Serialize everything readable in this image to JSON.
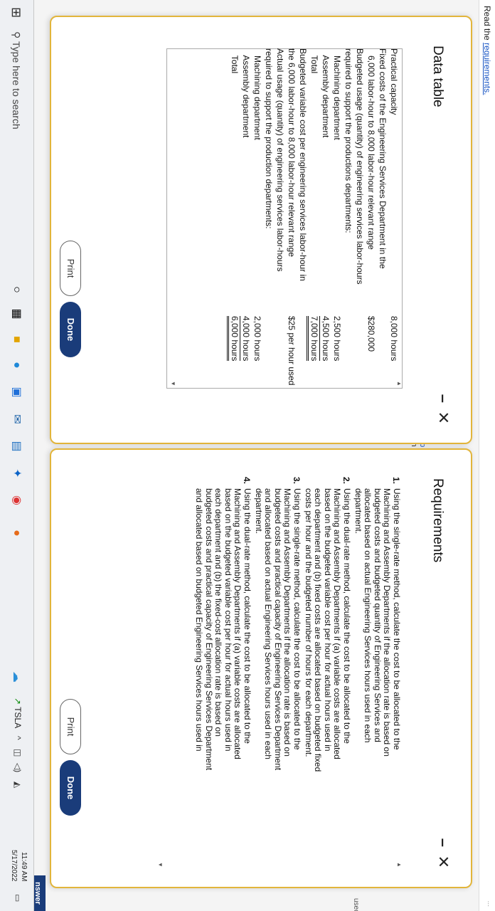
{
  "background": {
    "read_text": "Read the ",
    "read_link": "requirements.",
    "corner_text": "...",
    "used_text": "used",
    "answer_button": "nswer",
    "frag1": "ep",
    "frag2": "im"
  },
  "data_dialog": {
    "title": "Data table",
    "rows": [
      {
        "label": "Practical capacity",
        "value": "8,000 hours"
      },
      {
        "label": "Fixed costs of the Engineering Services Department in the",
        "value": ""
      },
      {
        "label": "   6,000 labor-hour to 8,000 labor-hour relevant range",
        "value": "$280,000"
      },
      {
        "label": "Budgeted usage (quantity) of engineering services labor-hours",
        "value": ""
      },
      {
        "label": "required to support the productions departments:",
        "value": ""
      },
      {
        "label": "   Machining department",
        "value": "2,500 hours"
      },
      {
        "label": "   Assembly department",
        "value": "4,500 hours"
      },
      {
        "label": "   Total",
        "value": "7,000 hours"
      },
      {
        "label": "Budgeted variable cost per engineering services labor-hour in",
        "value": ""
      },
      {
        "label": "the 6,000 labor-hour to 8,000 labor-hour relevant range",
        "value": "$25 per hour used"
      },
      {
        "label": "Actual usage (quantity) of engineering services labor-hours",
        "value": ""
      },
      {
        "label": "required to support the production departments:",
        "value": ""
      },
      {
        "label": "   Machining department",
        "value": "2,000 hours"
      },
      {
        "label": "   Assembly department",
        "value": "4,000 hours"
      },
      {
        "label": "   Total",
        "value": "6,000 hours"
      }
    ],
    "print_label": "Print",
    "done_label": "Done"
  },
  "req_dialog": {
    "title": "Requirements",
    "items": [
      {
        "num": "1.",
        "lines": [
          "Using the single-rate method, calculate the cost to be allocated to the",
          "Machining and Assembly Departments if the allocation rate is based on",
          "budgeted costs and budgeted quantity of Engineering Services and",
          "allocated based on actual Engineering Services hours used in each",
          "department."
        ]
      },
      {
        "num": "2.",
        "lines": [
          "Using the dual-rate method, calculate the cost to be allocated to the",
          "Machining and Assembly Departments if (a) variable costs are allocated",
          "based on the budgeted variable cost per hour for actual hours used in",
          "each department and (b) fixed costs are allocated based on budgeted fixed",
          "costs per hour and the budgeted number of hours for each department."
        ]
      },
      {
        "num": "3.",
        "lines": [
          "Using the single-rate method, calculate the cost to be allocated to the",
          "Machining and Assembly Departments if the allocation rate is based on",
          "budgeted costs and practical capacity of Engineering Services Department",
          "and allocated based on actual Engineering Services hours used in each",
          "department."
        ]
      },
      {
        "num": "4.",
        "lines": [
          "Using the dual-rate method, calculate the cost to be allocated to the",
          "Machining and Assembly Departments if (a) variable costs are allocated",
          "based on the budgeted variable cost per hour for actual hours used in",
          "each department and (b) the fixed-cost allocation rate is based on",
          "budgeted costs and practical capacity of Engineering Services Department",
          "and allocated based on budgeted Engineering Services hours used in"
        ]
      }
    ],
    "print_label": "Print",
    "done_label": "Done"
  },
  "taskbar": {
    "search_placeholder": "Type here to search",
    "ticker": "TSLA",
    "time": "11:49 AM",
    "date": "5/17/2022"
  }
}
